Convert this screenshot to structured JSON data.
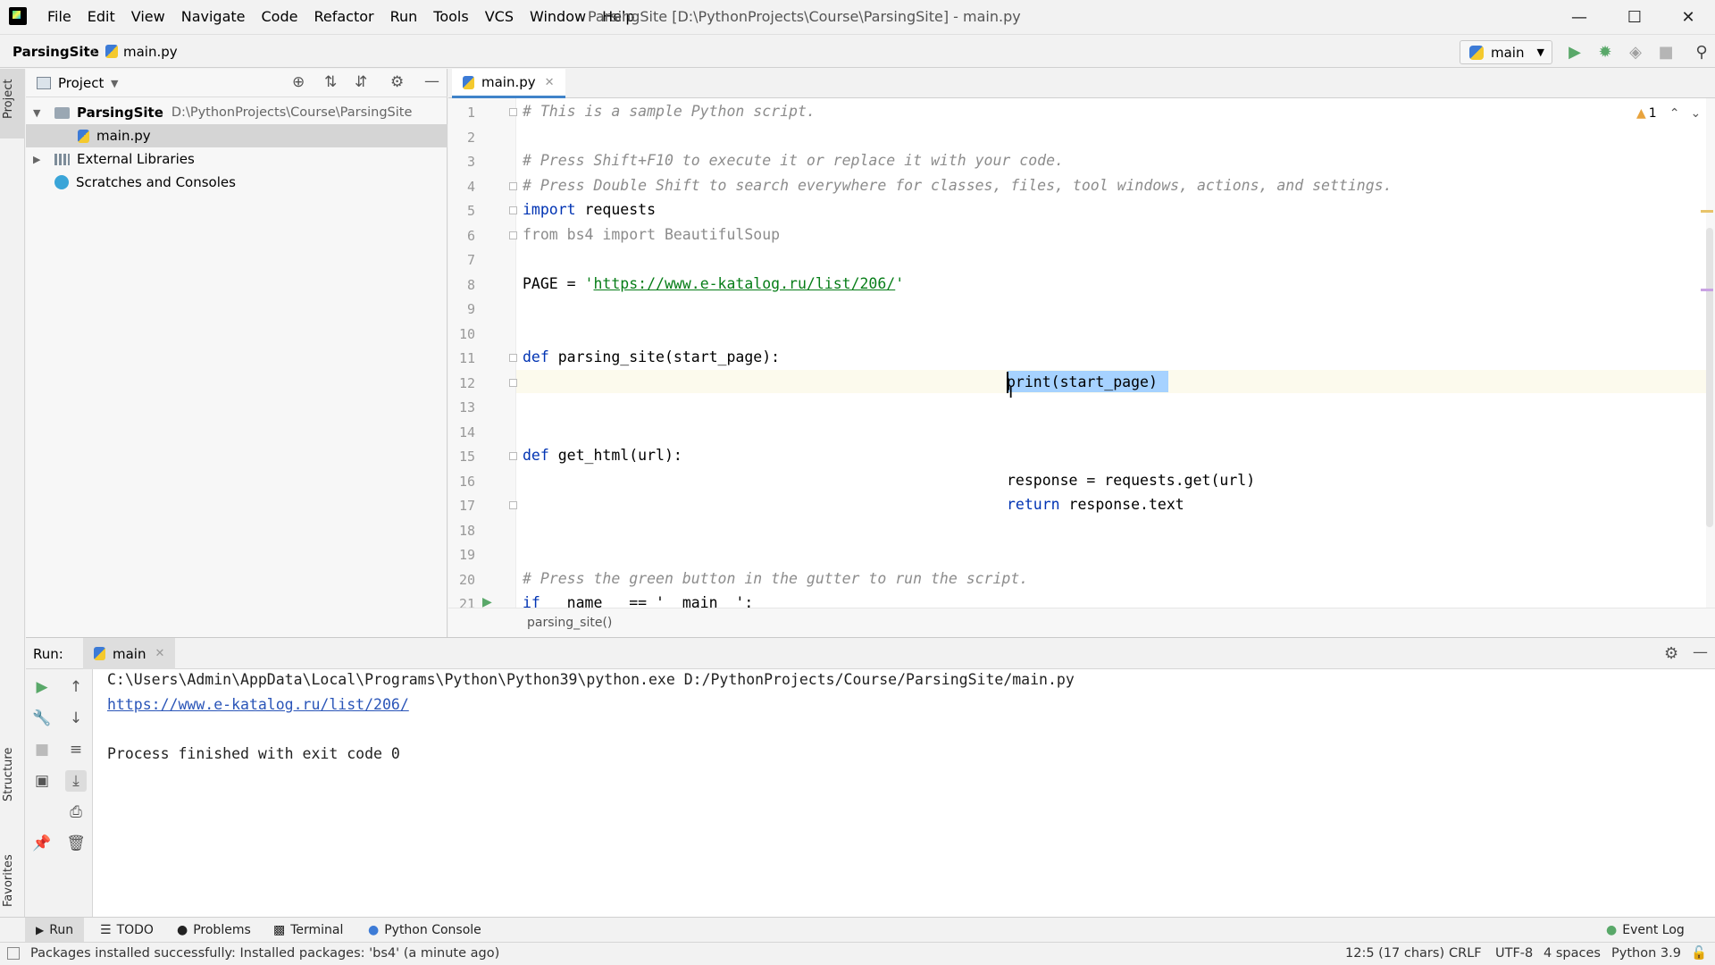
{
  "window": {
    "menu": [
      "File",
      "Edit",
      "View",
      "Navigate",
      "Code",
      "Refactor",
      "Run",
      "Tools",
      "VCS",
      "Window",
      "Help"
    ],
    "title": "ParsingSite [D:\\PythonProjects\\Course\\ParsingSite] - main.py"
  },
  "navbar": {
    "project": "ParsingSite",
    "file": "main.py",
    "run_config": "main"
  },
  "left_strip": {
    "project": "Project",
    "structure": "Structure",
    "favorites": "Favorites"
  },
  "project_panel": {
    "title": "Project",
    "tree": [
      {
        "label": "ParsingSite",
        "path": "D:\\PythonProjects\\Course\\ParsingSite"
      },
      {
        "label": "main.py"
      },
      {
        "label": "External Libraries"
      },
      {
        "label": "Scratches and Consoles"
      }
    ]
  },
  "editor": {
    "tab": "main.py",
    "warning_count": "1",
    "line_numbers": [
      "1",
      "2",
      "3",
      "4",
      "5",
      "6",
      "7",
      "8",
      "9",
      "10",
      "11",
      "12",
      "13",
      "14",
      "15",
      "16",
      "17",
      "18",
      "19",
      "20",
      "21"
    ],
    "lines": {
      "l1": "# This is a sample Python script.",
      "l3": "# Press Shift+F10 to execute it or replace it with your code.",
      "l4": "# Press Double Shift to search everywhere for classes, files, tool windows, actions, and settings.",
      "l5_kw": "import",
      "l5_rest": " requests",
      "l6": "from bs4 import BeautifulSoup",
      "l8_a": "PAGE = ",
      "l8_q1": "'",
      "l8_url": "https://www.e-katalog.ru/list/206/",
      "l8_q2": "'",
      "l11_kw": "def",
      "l11_rest": " parsing_site(start_page):",
      "l12": "print(start_page)",
      "l15_kw": "def",
      "l15_rest": " get_html(url):",
      "l16": "response = requests.get(url)",
      "l17_kw": "return",
      "l17_rest": " response.text",
      "l20": "# Press the green button in the gutter to run the script.",
      "l21_kw": "if",
      "l21_rest": " __name__ == '__main__':"
    },
    "breadcrumb": "parsing_site()"
  },
  "run_panel": {
    "label": "Run:",
    "tab": "main",
    "output": {
      "command": "C:\\Users\\Admin\\AppData\\Local\\Programs\\Python\\Python39\\python.exe D:/PythonProjects/Course/ParsingSite/main.py",
      "url": "https://www.e-katalog.ru/list/206/",
      "finished": "Process finished with exit code 0"
    }
  },
  "tool_tabs": {
    "run": "Run",
    "todo": "TODO",
    "problems": "Problems",
    "terminal": "Terminal",
    "python_console": "Python Console",
    "event_log": "Event Log"
  },
  "status": {
    "message": "Packages installed successfully: Installed packages: 'bs4' (a minute ago)",
    "position": "12:5 (17 chars)",
    "line_sep": "CRLF",
    "encoding": "UTF-8",
    "indent": "4 spaces",
    "interpreter": "Python 3.9"
  },
  "colors": {
    "keyword": "#0033b3",
    "string": "#067d17",
    "comment": "#8c8c8c",
    "selection": "#a6d2ff",
    "run_green": "#59a869"
  }
}
